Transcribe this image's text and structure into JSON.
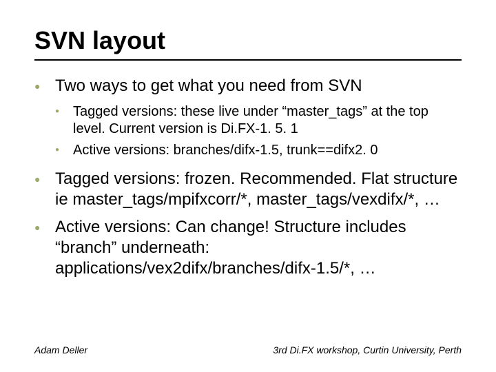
{
  "title": "SVN layout",
  "bullets": {
    "b1": "Two ways to get what you need from SVN",
    "b1a": "Tagged versions: these live under “master_tags” at the top level. Current version is Di.FX-1. 5. 1",
    "b1b": "Active versions: branches/difx-1.5, trunk==difx2. 0",
    "b2": "Tagged versions: frozen. Recommended. Flat structure ie master_tags/mpifxcorr/*, master_tags/vexdifx/*, …",
    "b3": "Active versions: Can change! Structure includes “branch” underneath: applications/vex2difx/branches/difx-1.5/*, …"
  },
  "footer": {
    "left": "Adam Deller",
    "right": "3rd Di.FX workshop, Curtin University, Perth"
  }
}
